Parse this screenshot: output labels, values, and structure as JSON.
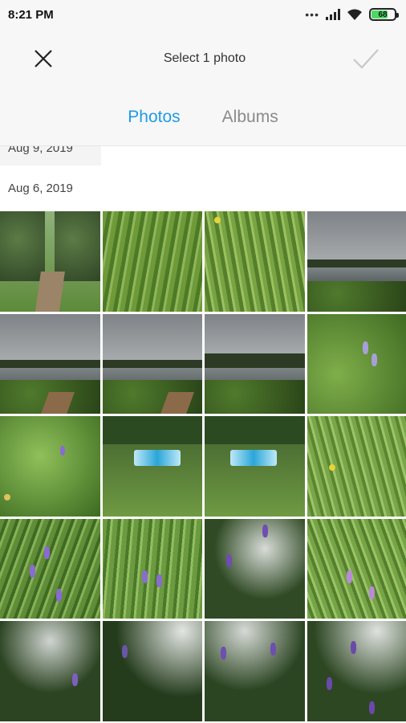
{
  "status_bar": {
    "time": "8:21 PM",
    "signal_dots": "•••",
    "battery_level": "68"
  },
  "header": {
    "title": "Select 1 photo",
    "close_icon": "close-icon",
    "confirm_icon": "checkmark-icon"
  },
  "tabs": [
    {
      "label": "Photos",
      "active": true
    },
    {
      "label": "Albums",
      "active": false
    }
  ],
  "gallery": {
    "previous_date": "Aug 9, 2019",
    "date": "Aug 6, 2019"
  },
  "colors": {
    "accent": "#1e9be6",
    "inactive_tab": "#8a8a8a",
    "bar_background": "#f7f7f7"
  }
}
